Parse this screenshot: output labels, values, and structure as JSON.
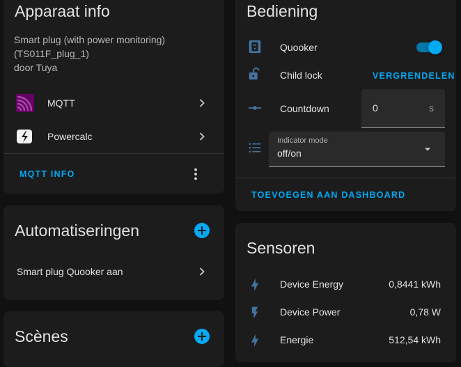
{
  "device_info": {
    "title": "Apparaat info",
    "model": "Smart plug (with power monitoring)",
    "model_id": "(TS011F_plug_1)",
    "manufacturer": "door Tuya",
    "integrations": [
      {
        "label": "MQTT",
        "icon": "mqtt-icon"
      },
      {
        "label": "Powercalc",
        "icon": "powercalc-icon"
      }
    ],
    "action_label": "MQTT INFO",
    "menu_icon": "dots-vertical-icon"
  },
  "automations": {
    "title": "Automatiseringen",
    "items": [
      {
        "label": "Smart plug Quooker aan"
      }
    ]
  },
  "scenes": {
    "title": "Scènes"
  },
  "controls": {
    "title": "Bediening",
    "quooker": {
      "label": "Quooker",
      "state": "on",
      "icon": "power-socket-icon"
    },
    "child_lock": {
      "label": "Child lock",
      "action": "VERGRENDELEN",
      "icon": "lock-open-icon"
    },
    "countdown": {
      "label": "Countdown",
      "value": "0",
      "unit": "s",
      "icon": "ray-vertex-icon"
    },
    "indicator": {
      "field_label": "Indicator mode",
      "value": "off/on",
      "icon": "format-list-icon"
    },
    "add_to_dashboard": "TOEVOEGEN AAN DASHBOARD"
  },
  "sensors": {
    "title": "Sensoren",
    "items": [
      {
        "label": "Device Energy",
        "value": "0,8441 kWh",
        "icon": "lightning-bolt-icon"
      },
      {
        "label": "Device Power",
        "value": "0,78 W",
        "icon": "flash-icon"
      },
      {
        "label": "Energie",
        "value": "512,54 kWh",
        "icon": "lightning-bolt-icon"
      }
    ]
  },
  "colors": {
    "background": "#111111",
    "card": "#1c1c1c",
    "accent": "#03a9f4",
    "icon": "#44739e",
    "mqtt": "#660066"
  }
}
